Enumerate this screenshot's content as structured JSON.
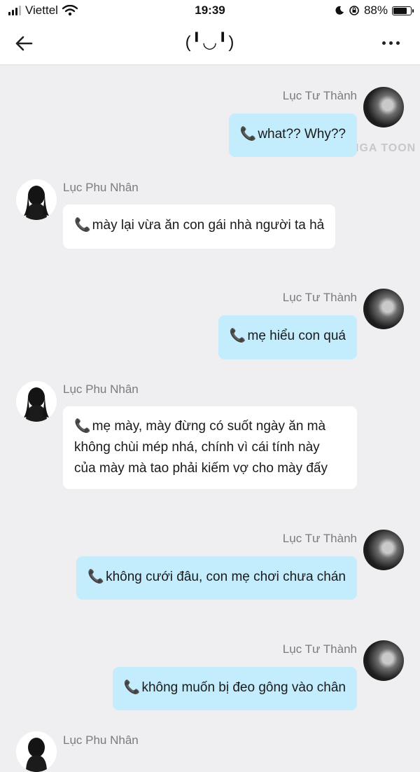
{
  "status_bar": {
    "carrier": "Viettel",
    "time": "19:39",
    "battery_percent": "88%",
    "battery_level": 0.88
  },
  "header": {
    "title": "(╹◡╹)"
  },
  "watermark": "MANGA TOON",
  "messages": [
    {
      "sender": "Lục Tư Thành",
      "side": "right",
      "icon": "phone-icon",
      "text": "what?? Why??"
    },
    {
      "sender": "Lục Phu Nhân",
      "side": "left",
      "icon": "phone-icon",
      "text": "mày lại vừa ăn con gái nhà người ta hả"
    },
    {
      "sender": "Lục Tư Thành",
      "side": "right",
      "icon": "phone-icon",
      "text": "mẹ hiểu con quá"
    },
    {
      "sender": "Lục Phu Nhân",
      "side": "left",
      "icon": "phone-icon",
      "text_lines": [
        "mẹ mày, mày đừng có suốt ngày ăn mà",
        "không chùi mép nhá, chính vì cái tính này",
        "của mày mà tao phải kiếm vợ cho mày đấy"
      ]
    },
    {
      "sender": "Lục Tư Thành",
      "side": "right",
      "icon": "phone-icon",
      "text": "không cưới đâu, con mẹ chơi chưa chán"
    },
    {
      "sender": "Lục Tư Thành",
      "side": "right",
      "icon": "phone-icon",
      "text": "không muốn bị đeo gông vào chân"
    },
    {
      "sender": "Lục Phu Nhân",
      "side": "left"
    }
  ]
}
